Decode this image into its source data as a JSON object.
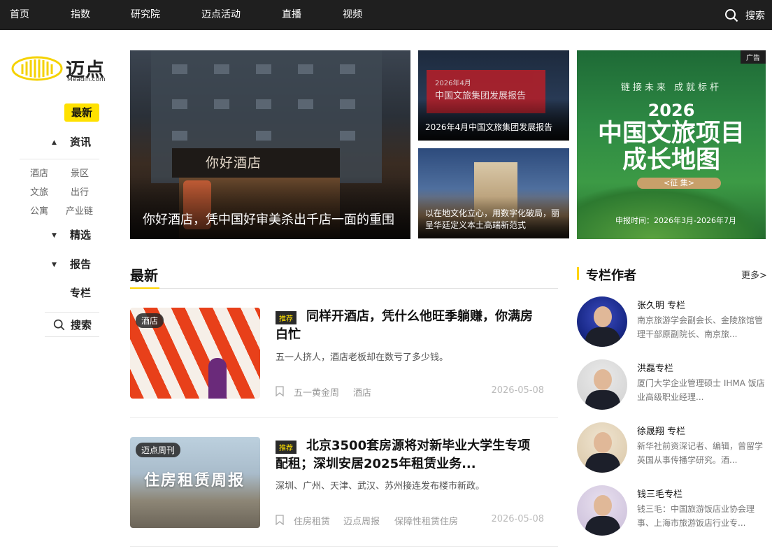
{
  "topnav": {
    "items": [
      "首页",
      "指数",
      "研究院",
      "迈点活动",
      "直播",
      "视频"
    ],
    "search_label": "搜索",
    "icon": "search-icon"
  },
  "logo": {
    "text": "迈点",
    "sub": "Meadin.com"
  },
  "sidebar": {
    "latest": "最新",
    "news": "资讯",
    "news_subs": [
      "酒店",
      "景区",
      "文旅",
      "出行",
      "公寓",
      "产业链"
    ],
    "featured": "精选",
    "reports": "报告",
    "column": "专栏",
    "search": "搜索"
  },
  "hero": {
    "main": {
      "sign": "你好酒店",
      "caption": "你好酒店，凭中国好审美杀出千店一面的重围"
    },
    "side1": {
      "banner_date": "2026年4月",
      "banner_title": "中国文旅集团发展报告",
      "caption": "2026年4月中国文旅集团发展报告"
    },
    "side2": {
      "caption": "以在地文化立心，用数字化破局，丽呈华廷定义本土高端新范式"
    }
  },
  "ad": {
    "badge": "广告",
    "slogan": "链接未来  成就标杆",
    "year": "2026",
    "title1": "中国文旅项目",
    "title2": "成长地图",
    "collect": "<征 集>",
    "period": "申报时间：2026年3月-2026年7月"
  },
  "latest": {
    "heading": "最新",
    "articles": [
      {
        "tag": "酒店",
        "badge": "推荐",
        "title": "同样开酒店，凭什么他旺季躺赚，你满房白忙",
        "desc": "五一人挤人，酒店老板却在数亏了多少钱。",
        "tags": [
          "五一黄金周",
          "酒店"
        ],
        "date": "2026-05-08"
      },
      {
        "tag": "迈点周刊",
        "badge": "推荐",
        "title": "北京3500套房源将对新毕业大学生专项配租；深圳安居2025年租赁业务...",
        "desc": "深圳、广州、天津、武汉、苏州接连发布楼市新政。",
        "tags": [
          "住房租赁",
          "迈点周报",
          "保障性租赁住房"
        ],
        "date": "2026-05-08",
        "thumb_text": "住房租赁周报"
      }
    ]
  },
  "columnists": {
    "heading": "专栏作者",
    "more": "更多>",
    "authors": [
      {
        "name": "张久明 专栏",
        "bio": "南京旅游学会副会长、金陵旅馆管理干部原副院长、南京旅..."
      },
      {
        "name": "洪磊专栏",
        "bio": "厦门大学企业管理硕士 IHMA 饭店业高级职业经理..."
      },
      {
        "name": "徐晟翔 专栏",
        "bio": "新华社前资深记者、编辑，曾留学英国从事传播学研究。酒..."
      },
      {
        "name": "钱三毛专栏",
        "bio": "钱三毛：中国旅游饭店业协会理事、上海市旅游饭店行业专..."
      }
    ]
  },
  "colors": {
    "accent": "#ffe100",
    "topbar": "#1f1f1f"
  }
}
